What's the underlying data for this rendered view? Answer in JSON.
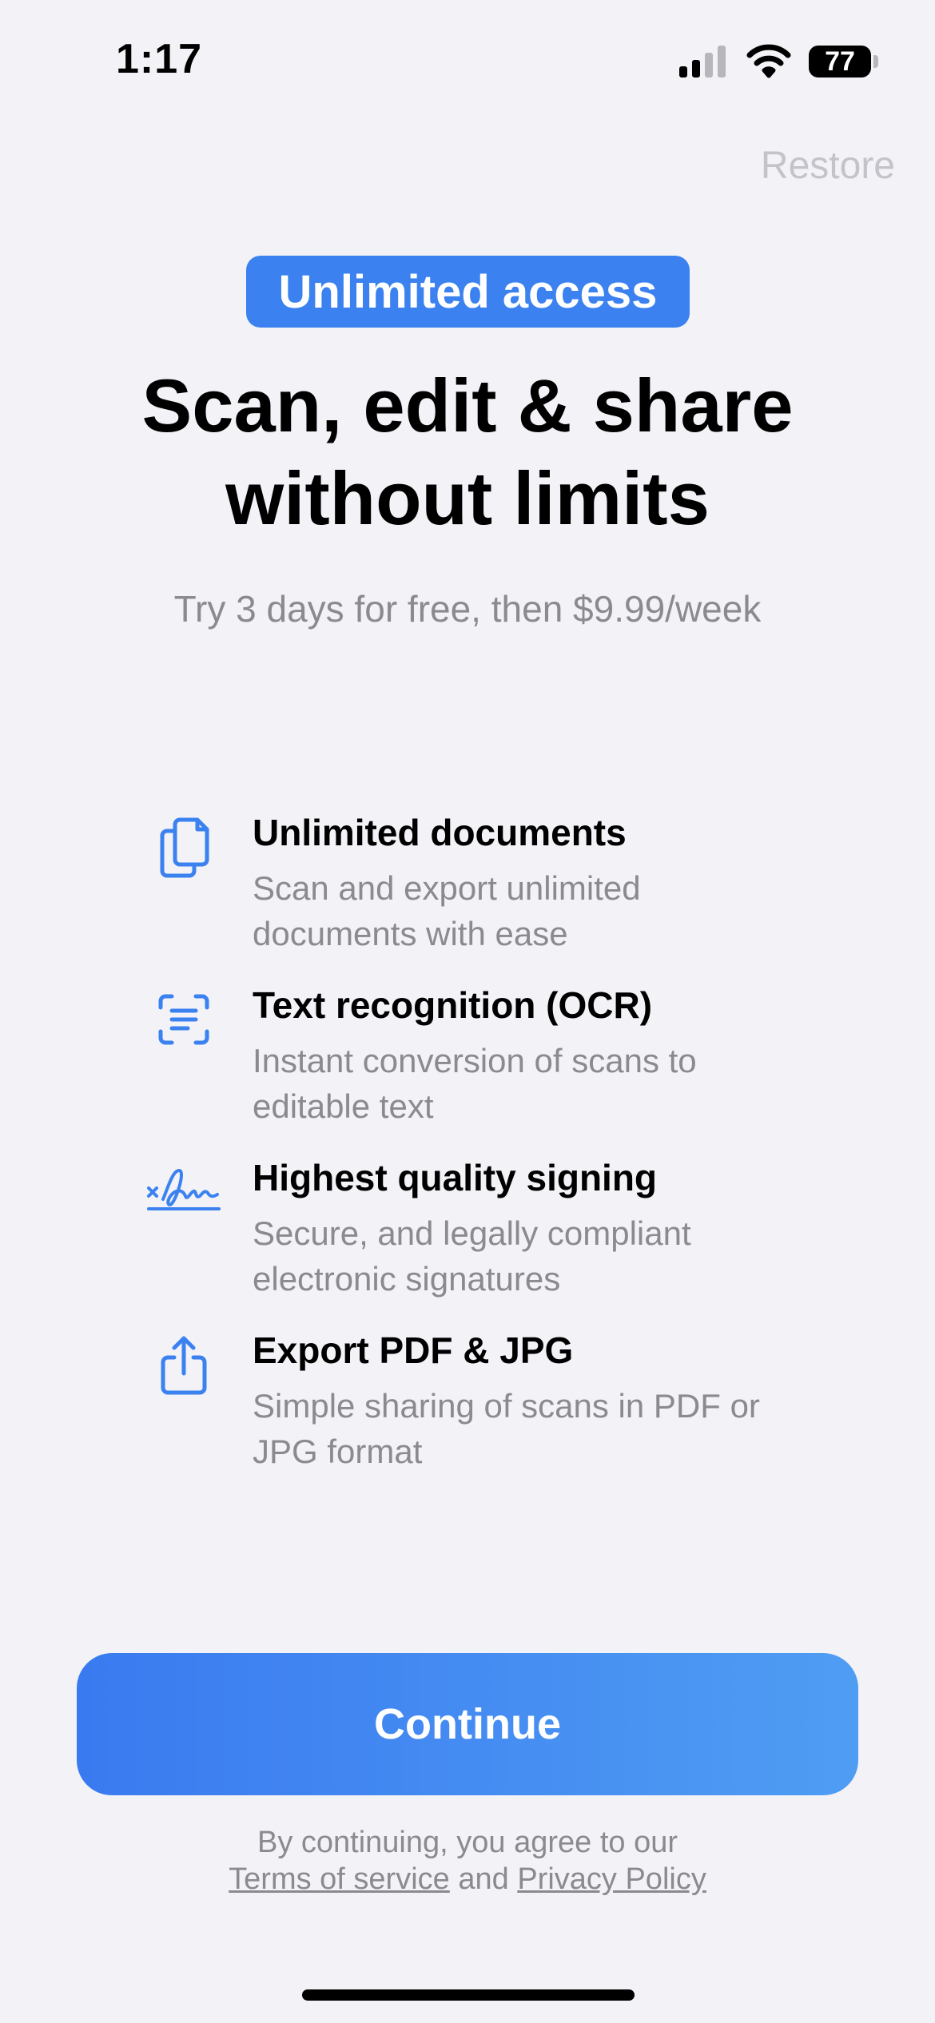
{
  "status_bar": {
    "time": "1:17",
    "battery": "77",
    "icons": [
      "signal-icon",
      "wifi-icon",
      "battery-icon"
    ]
  },
  "header": {
    "restore_label": "Restore"
  },
  "badge": {
    "label": "Unlimited access",
    "color": "#3b82f0"
  },
  "headline": {
    "line1": "Scan, edit & share",
    "line2": "without limits"
  },
  "subtitle": "Try 3 days for free, then $9.99/week",
  "features": [
    {
      "icon": "documents-icon",
      "title": "Unlimited documents",
      "description": "Scan and export unlimited documents with ease"
    },
    {
      "icon": "text-recognition-icon",
      "title": "Text recognition (OCR)",
      "description": "Instant conversion of scans to editable text"
    },
    {
      "icon": "signature-icon",
      "title": "Highest quality signing",
      "description": "Secure, and legally compliant electronic signatures"
    },
    {
      "icon": "share-icon",
      "title": "Export PDF & JPG",
      "description": "Simple sharing of scans in PDF or JPG format"
    }
  ],
  "cta": {
    "continue_label": "Continue"
  },
  "legal": {
    "prefix": "By continuing, you agree to our",
    "terms_label": "Terms of service",
    "conjunction": "and",
    "privacy_label": "Privacy Policy"
  },
  "colors": {
    "accent": "#3b82f0",
    "background": "#f2f2f7",
    "secondary_text": "#8a8a8f"
  }
}
